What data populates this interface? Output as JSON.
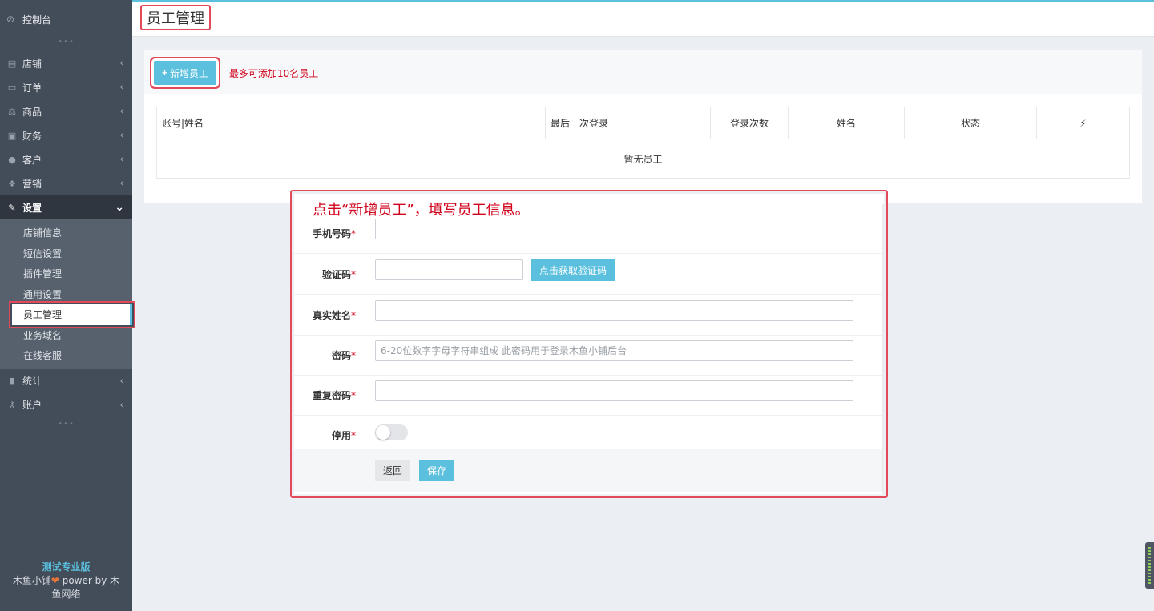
{
  "sidebar": {
    "dashboard": {
      "label": "控制台",
      "icon": "dashboard-icon"
    },
    "items": [
      {
        "label": "店铺",
        "icon": "store-icon"
      },
      {
        "label": "订单",
        "icon": "order-icon"
      },
      {
        "label": "商品",
        "icon": "scale-icon"
      },
      {
        "label": "财务",
        "icon": "money-icon"
      },
      {
        "label": "客户",
        "icon": "users-icon"
      },
      {
        "label": "营销",
        "icon": "marketing-icon"
      },
      {
        "label": "设置",
        "icon": "wrench-icon"
      }
    ],
    "settings_sub": [
      {
        "label": "店铺信息"
      },
      {
        "label": "短信设置"
      },
      {
        "label": "插件管理"
      },
      {
        "label": "通用设置"
      },
      {
        "label": "员工管理"
      },
      {
        "label": "业务域名"
      },
      {
        "label": "在线客服"
      }
    ],
    "bottom_items": [
      {
        "label": "统计",
        "icon": "bar-chart-icon"
      },
      {
        "label": "账户",
        "icon": "key-icon"
      }
    ],
    "footer": {
      "edition": "测试专业版",
      "brand_line1": "木鱼小铺",
      "brand_line2": "power by 木",
      "brand_line3": "鱼网络"
    }
  },
  "header": {
    "title": "员工管理"
  },
  "main": {
    "add_button": "新增员工",
    "limit_note": "最多可添加10名员工",
    "table": {
      "columns": [
        "账号|姓名",
        "最后一次登录",
        "登录次数",
        "姓名",
        "状态",
        "⚡"
      ],
      "empty_text": "暂无员工"
    }
  },
  "form": {
    "note": "点击“新增员工”，填写员工信息。",
    "phone_label": "手机号码",
    "code_label": "验证码",
    "code_button": "点击获取验证码",
    "realname_label": "真实姓名",
    "password_label": "密码",
    "password_placeholder": "6-20位数字字母字符串组成 此密码用于登录木鱼小铺后台",
    "repeat_password_label": "重复密码",
    "disable_label": "停用",
    "disabled": false,
    "back_button": "返回",
    "save_button": "保存"
  },
  "colors": {
    "accent": "#5bc0de",
    "sidebar_bg": "#434c59",
    "highlight_red": "#e24a5a"
  }
}
